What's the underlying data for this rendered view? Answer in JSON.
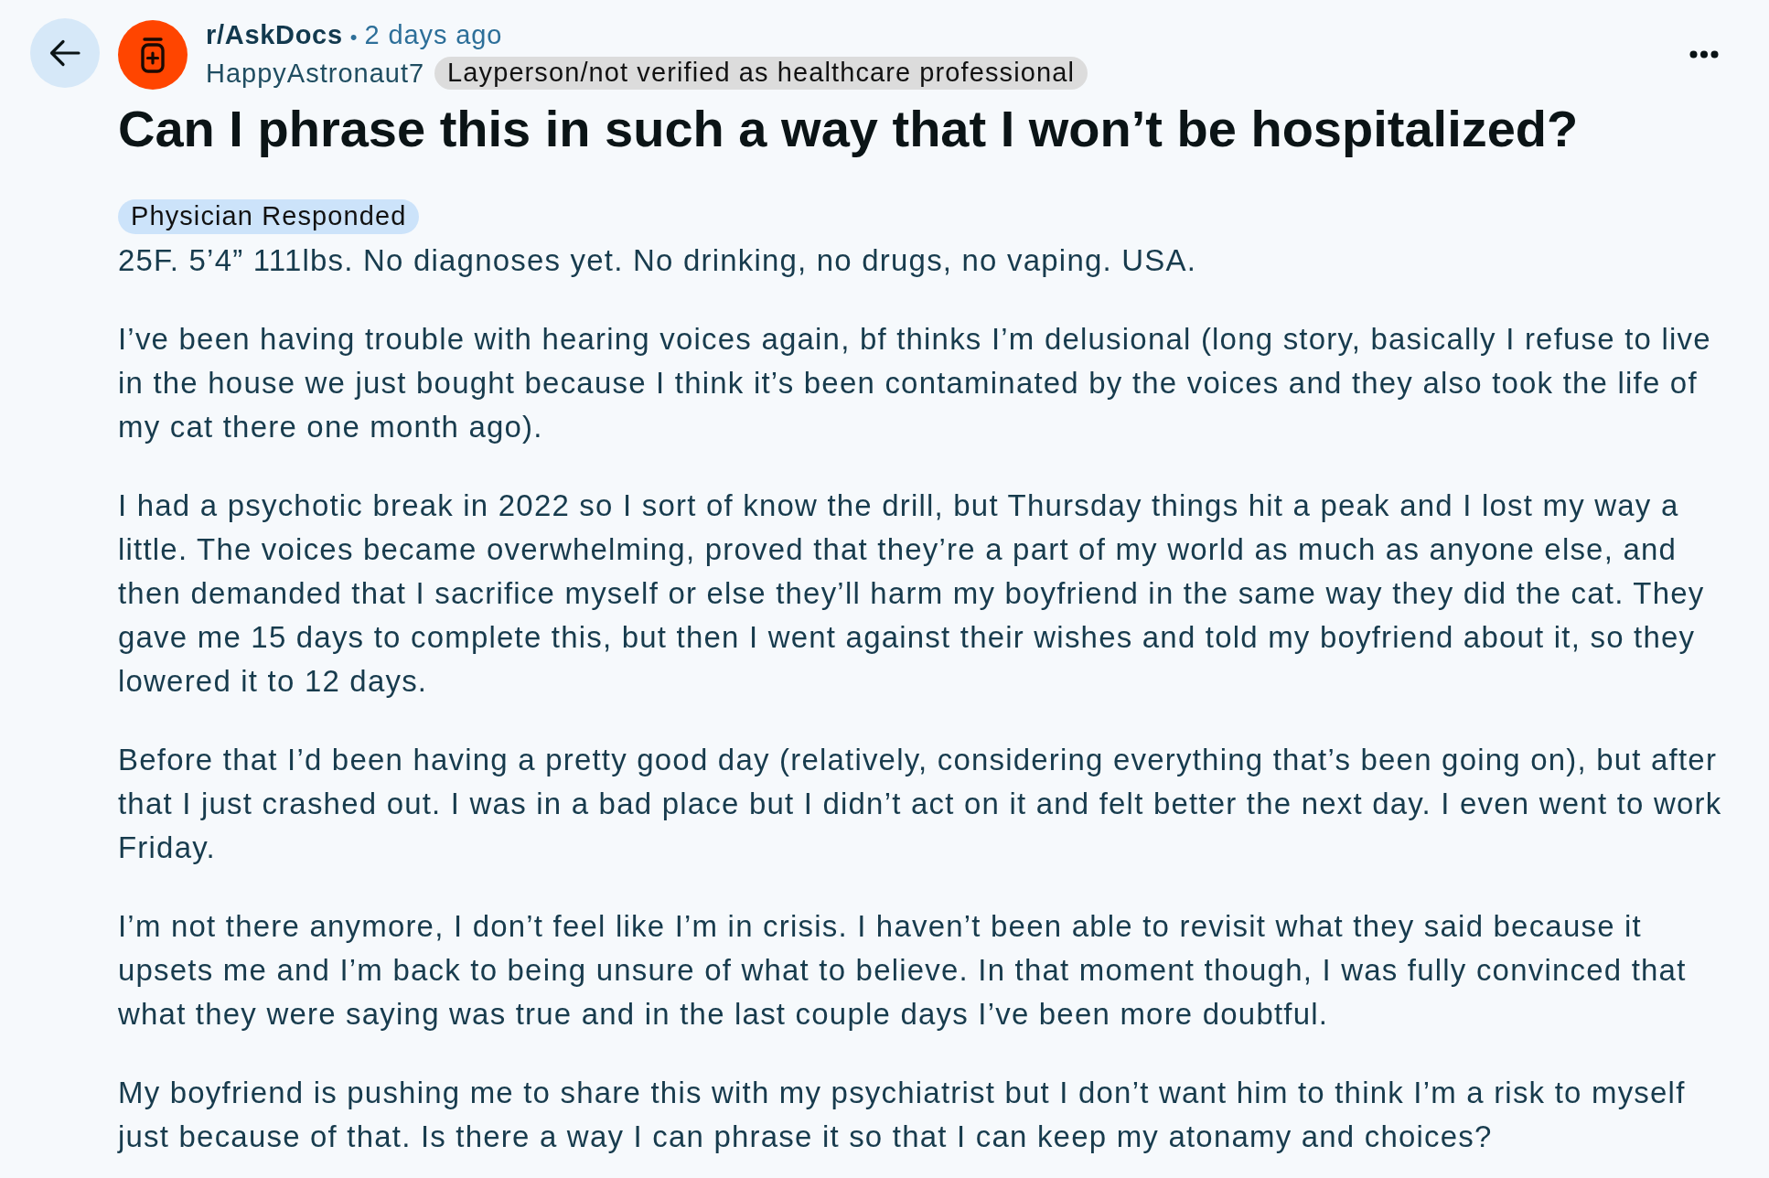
{
  "post": {
    "subreddit": "r/AskDocs",
    "separator": "•",
    "time": "2 days ago",
    "author": "HappyAstronaut7",
    "author_flair": "Layperson/not verified as healthcare professional",
    "title": "Can I phrase this in such a way that I won’t be hospitalized?",
    "post_flair": "Physician Responded",
    "body": [
      "25F. 5’4” 111lbs. No diagnoses yet. No drinking, no drugs, no vaping. USA.",
      "I’ve been having trouble with hearing voices again, bf thinks I’m delusional (long story, basically I refuse to live in the house we just bought because I think it’s been contaminated by the voices and they also took the life of my cat there one month ago).",
      "I had a psychotic break in 2022 so I sort of know the drill, but Thursday things hit a peak and I lost my way a little. The voices became overwhelming, proved that they’re a part of my world as much as anyone else, and then demanded that I sacrifice myself or else they’ll harm my boyfriend in the same way they did the cat. They gave me 15 days to complete this, but then I went against their wishes and told my boyfriend about it, so they lowered it to 12 days.",
      "Before that I’d been having a pretty good day (relatively, considering everything that’s been going on), but after that I just crashed out. I was in a bad place but I didn’t act on it and felt better the next day. I even went to work Friday.",
      "I’m not there anymore, I don’t feel like I’m in crisis. I haven’t been able to revisit what they said because it upsets me and I’m back to being unsure of what to believe. In that moment though, I was fully convinced that what they were saying was true and in the last couple days I’ve been more doubtful.",
      "My boyfriend is pushing me to share this with my psychiatrist but I don’t want him to think I’m a risk to myself just because of that. Is there a way I can phrase it so that I can keep my atonamy and choices?"
    ]
  }
}
